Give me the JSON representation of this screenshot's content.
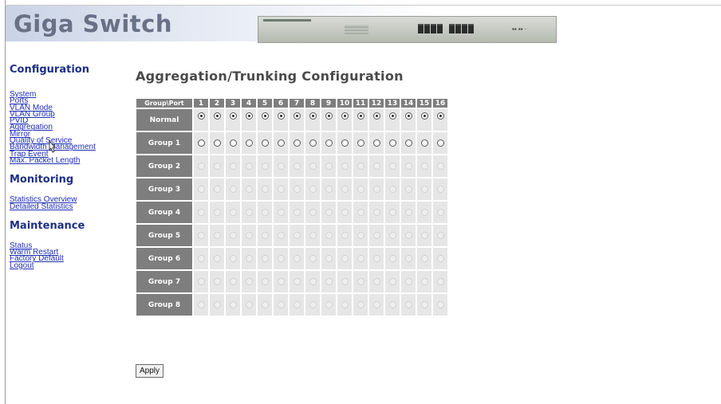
{
  "app": {
    "logo": "Giga Switch"
  },
  "sidebar": {
    "sections": [
      {
        "title": "Configuration",
        "items": [
          "System",
          "Ports",
          "VLAN Mode",
          "VLAN Group",
          "PVID",
          "Aggregation",
          "Mirror",
          "Quality of Service",
          "Bandwidth Management",
          "Trap Event",
          "Max. Packet Length"
        ]
      },
      {
        "title": "Monitoring",
        "items": [
          "Statistics Overview",
          "Detailed Statistics"
        ]
      },
      {
        "title": "Maintenance",
        "items": [
          "Status",
          "Warm Restart",
          "Factory Default",
          "Logout"
        ]
      }
    ]
  },
  "page": {
    "title": "Aggregation/Trunking Configuration"
  },
  "grid": {
    "corner_label": "Group\\Port",
    "ports": [
      "1",
      "2",
      "3",
      "4",
      "5",
      "6",
      "7",
      "8",
      "9",
      "10",
      "11",
      "12",
      "13",
      "14",
      "15",
      "16"
    ],
    "rows": [
      {
        "label": "Normal",
        "state": "checked"
      },
      {
        "label": "Group 1",
        "state": "enabled"
      },
      {
        "label": "Group 2",
        "state": "disabled"
      },
      {
        "label": "Group 3",
        "state": "disabled"
      },
      {
        "label": "Group 4",
        "state": "disabled"
      },
      {
        "label": "Group 5",
        "state": "disabled"
      },
      {
        "label": "Group 6",
        "state": "disabled"
      },
      {
        "label": "Group 7",
        "state": "disabled"
      },
      {
        "label": "Group 8",
        "state": "disabled"
      }
    ]
  },
  "actions": {
    "apply_label": "Apply"
  },
  "colors": {
    "nav_link": "#1f2fb4",
    "section_head": "#1e2f86",
    "header_cell": "#7e7e7e",
    "cell_bg": "#e6e6e6"
  }
}
